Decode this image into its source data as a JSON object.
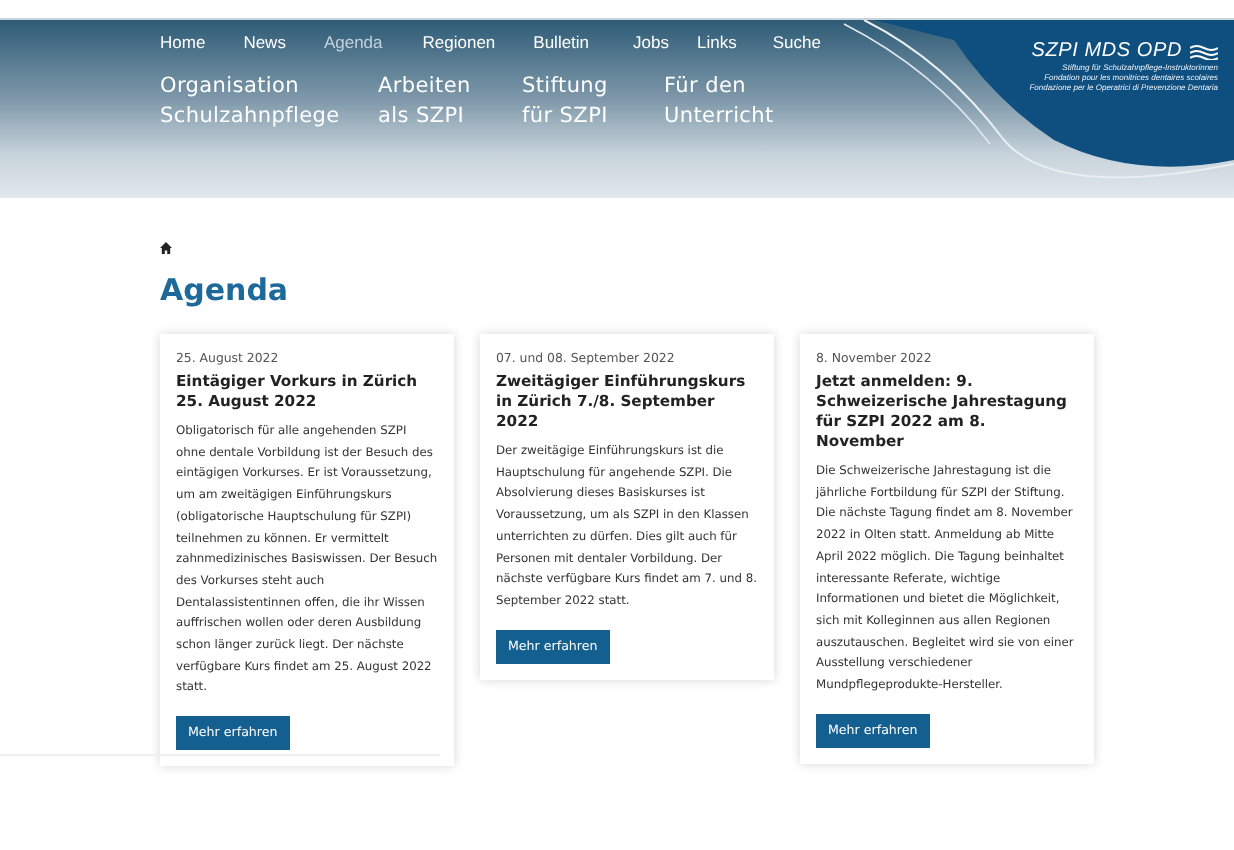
{
  "nav": {
    "items": [
      {
        "label": "Home",
        "selected": false
      },
      {
        "label": "News",
        "selected": false
      },
      {
        "label": "Agenda",
        "selected": true
      },
      {
        "label": "Regionen",
        "selected": false
      },
      {
        "label": "Bulletin",
        "selected": false
      },
      {
        "label": "Jobs",
        "selected": false
      },
      {
        "label": "Links",
        "selected": false
      },
      {
        "label": "Suche",
        "selected": false
      }
    ]
  },
  "main_menu": [
    {
      "lines": [
        "Organisation",
        "Schulzahnpflege"
      ]
    },
    {
      "lines": [
        "Arbeiten",
        "als SZPI"
      ]
    },
    {
      "lines": [
        "Stiftung",
        "für SZPI"
      ]
    },
    {
      "lines": [
        "Für den",
        "Unterricht"
      ]
    }
  ],
  "logo": {
    "title": "SZPI MDS OPD",
    "subtitle": [
      "Stiftung für Schulzahnpflege-Instruktorinnen",
      "Fondation pour les monitrices dentaires scolaires",
      "Fondazione per le Operatrici di Prevenzione Dentaria"
    ]
  },
  "page_title": "Agenda",
  "events": [
    {
      "date": "25. August 2022",
      "title": "Eintägiger Vorkurs in Zürich 25. August 2022",
      "text": "Obligatorisch für alle angehenden SZPI ohne dentale Vorbildung ist der Besuch des eintägigen Vorkurses. Er ist Voraussetzung, um am zweitägigen Einführungskurs (obligatorische Hauptschulung für SZPI) teilnehmen zu können. Er vermittelt zahnmedizinisches Basiswissen. Der Besuch des Vorkurses steht auch Dentalassistentinnen offen, die ihr Wissen auffrischen wollen oder deren Ausbildung schon länger zurück liegt. Der nächste verfügbare Kurs findet am 25. August 2022 statt.",
      "button": "Mehr erfahren"
    },
    {
      "date": "07. und 08. September 2022",
      "title": "Zweitägiger Einführungskurs in Zürich 7./8. September 2022",
      "text": "Der zweitägige Einführungskurs ist die Hauptschulung für angehende SZPI. Die Absolvierung dieses Basiskurses ist Voraussetzung, um als SZPI in den Klassen unterrichten zu dürfen. Dies gilt auch für Personen mit dentaler Vorbildung. Der nächste verfügbare Kurs findet am 7. und 8. September 2022 statt.",
      "button": "Mehr erfahren"
    },
    {
      "date": "8. November 2022",
      "title": "Jetzt anmelden: 9. Schweizerische Jahrestagung für SZPI 2022 am 8. November",
      "text": "Die Schweizerische Jahrestagung ist die jährliche Fortbildung für SZPI der Stiftung. Die nächste Tagung findet am 8. November 2022 in Olten statt. Anmeldung ab Mitte April 2022 möglich. Die Tagung beinhaltet interessante Referate, wichtige Informationen und bietet die Möglichkeit, sich mit Kolleginnen aus allen Regionen auszutauschen. Begleitet wird sie von einer Ausstellung verschiedener Mundpflegeprodukte-Hersteller.",
      "button": "Mehr erfahren"
    }
  ]
}
